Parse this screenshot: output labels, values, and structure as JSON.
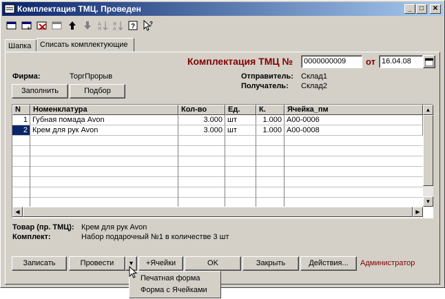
{
  "window": {
    "title": "Комплектация ТМЦ. Проведен"
  },
  "toolbar": {
    "icons": [
      "new-row-icon",
      "add-row-icon",
      "delete-row-icon",
      "copy-row-icon",
      "move-up-icon",
      "move-down-icon",
      "sort-asc-icon",
      "sort-desc-icon",
      "help-icon",
      "context-help-icon"
    ]
  },
  "tabs": [
    {
      "label": "Шапка"
    },
    {
      "label": "Списать комплектующие"
    }
  ],
  "header": {
    "doc_title": "Комплектация ТМЦ №",
    "doc_number": "0000000009",
    "date_label": "от",
    "date": "16.04.08"
  },
  "firm": {
    "label": "Фирма:",
    "value": "ТоргПрорыв"
  },
  "sender": {
    "label": "Отправитель:",
    "value": "Склад1"
  },
  "receiver": {
    "label": "Получатель:",
    "value": "Склад2"
  },
  "buttons": {
    "fill": "Заполнить",
    "select": "Подбор"
  },
  "table": {
    "columns": [
      "N",
      "Номенклатура",
      "Кол-во",
      "Ед.",
      "К.",
      "Ячейка_пм"
    ],
    "rows": [
      [
        "1",
        "Губная помада Avon",
        "3.000",
        "шт",
        "1.000",
        "А00-0006"
      ],
      [
        "2",
        "Крем для рук Avon",
        "3.000",
        "шт",
        "1.000",
        "А00-0008"
      ]
    ]
  },
  "info": {
    "product_label": "Товар (пр. ТМЦ):",
    "product_value": "Крем для рук Avon",
    "kit_label": "Комплект:",
    "kit_value": "Набор подарочный №1 в количестве 3 шт"
  },
  "footer": {
    "save": "Записать",
    "post": "Провести",
    "cells": "+Ячейки",
    "ok": "OK",
    "close": "Закрыть",
    "actions": "Действия...",
    "user": "Администратор"
  },
  "dropdown": {
    "items": [
      "Печатная форма",
      "Форма с Ячейками"
    ]
  },
  "colors": {
    "title_bar": "#0a246a",
    "selection": "#0a246a",
    "doc_title": "#800000",
    "face": "#d4d0c8"
  }
}
